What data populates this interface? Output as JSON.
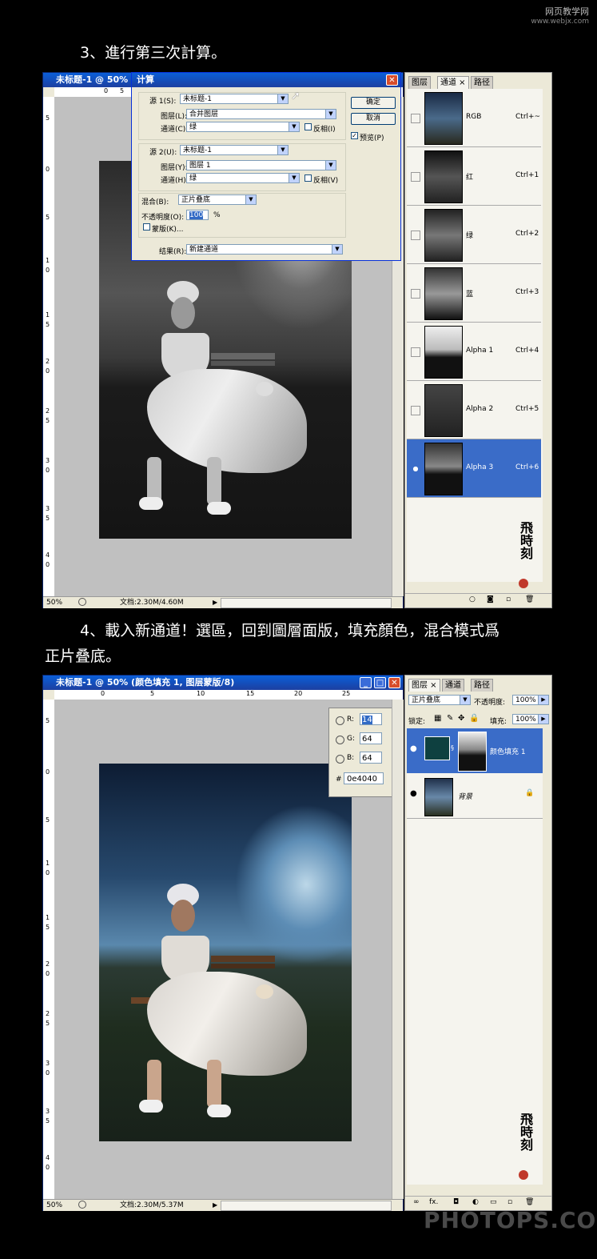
{
  "watermark_top": {
    "line1": "网页教学网",
    "line2": "www.webjx.com"
  },
  "step3": {
    "text": "3、進行第三次計算。"
  },
  "win1": {
    "title": "未标题-1 @ 50%",
    "zoom": "50%",
    "doc": "文档:2.30M/4.60M"
  },
  "ruler1": {
    "h_labels": [
      "0",
      "5"
    ],
    "v_labels": [
      "5",
      "0",
      "5",
      "1",
      "0",
      "1",
      "5",
      "2",
      "0",
      "2",
      "5",
      "3",
      "0",
      "3",
      "5",
      "4",
      "0"
    ]
  },
  "calc": {
    "title": "计算",
    "src1_label": "源 1(S):",
    "src1_value": "未标题-1",
    "layer1_label": "图层(L):",
    "layer1_value": "合并图层",
    "channel1_label": "通道(C):",
    "channel1_value": "绿",
    "invert1": "反相(I)",
    "src2_label": "源 2(U):",
    "src2_value": "未标题-1",
    "layer2_label": "图层(Y):",
    "layer2_value": "图层 1",
    "channel2_label": "通道(H):",
    "channel2_value": "绿",
    "invert2": "反相(V)",
    "blend_label": "混合(B):",
    "blend_value": "正片叠底",
    "opacity_label": "不透明度(O):",
    "opacity_value": "100",
    "opacity_unit": "%",
    "mask_label": "蒙版(K)...",
    "result_label": "结果(R):",
    "result_value": "新建通道",
    "ok": "确定",
    "cancel": "取消",
    "preview": "预览(P)"
  },
  "panel1": {
    "tabs": [
      "图层",
      "通道 ×",
      "路径"
    ],
    "channels": [
      {
        "name": "RGB",
        "key": "Ctrl+~"
      },
      {
        "name": "红",
        "key": "Ctrl+1"
      },
      {
        "name": "绿",
        "key": "Ctrl+2"
      },
      {
        "name": "蓝",
        "key": "Ctrl+3"
      },
      {
        "name": "Alpha 1",
        "key": "Ctrl+4"
      },
      {
        "name": "Alpha 2",
        "key": "Ctrl+5"
      },
      {
        "name": "Alpha 3",
        "key": "Ctrl+6"
      }
    ]
  },
  "step4": {
    "line1": "4、載入新通道！選區，回到圖層面版，填充顏色，混合模式爲",
    "line2": "正片叠底。"
  },
  "win2": {
    "title": "未标题-1 @ 50% (颜色填充 1, 图层蒙版/8)",
    "zoom": "50%",
    "doc": "文档:2.30M/5.37M"
  },
  "ruler2": {
    "h_labels": [
      "0",
      "5",
      "10",
      "15",
      "20",
      "25"
    ],
    "v_labels": [
      "5",
      "0",
      "5",
      "1",
      "0",
      "1",
      "5",
      "2",
      "0",
      "2",
      "5",
      "3",
      "0",
      "3",
      "5",
      "4",
      "0"
    ]
  },
  "color_picker": {
    "r_label": "R:",
    "r": "14",
    "g_label": "G:",
    "g": "64",
    "b_label": "B:",
    "b": "64",
    "hash": "#",
    "hex": "0e4040"
  },
  "panel2": {
    "tabs": [
      "图层 ×",
      "通道",
      "路径"
    ],
    "blend_mode": "正片叠底",
    "opacity_label": "不透明度:",
    "opacity": "100%",
    "lock_label": "锁定:",
    "fill_label": "填充:",
    "fill": "100%",
    "layers": [
      {
        "name": "颜色填充 1"
      },
      {
        "name": "背景"
      }
    ],
    "fill_swatch_color": "#0e4040"
  },
  "watermark_bottom": "PHOTOPS.COM"
}
